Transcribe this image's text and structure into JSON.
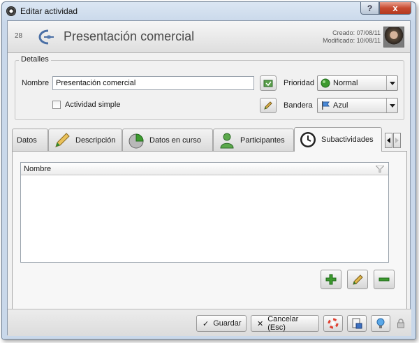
{
  "window": {
    "title": "Editar actividad",
    "help_glyph": "?",
    "close_glyph": "x"
  },
  "header": {
    "record_id": "28",
    "title": "Presentación comercial",
    "created": "Creado: 07/08/11",
    "modified": "Modificado: 10/08/11"
  },
  "details": {
    "legend": "Detalles",
    "name_label": "Nombre",
    "name_value": "Presentación comercial",
    "simple_label": "Actividad simple",
    "priority_label": "Prioridad",
    "priority_value": "Normal",
    "flag_label": "Bandera",
    "flag_value": "Azul"
  },
  "tabs": [
    {
      "label": "Datos"
    },
    {
      "label": "Descripción"
    },
    {
      "label": "Datos en curso"
    },
    {
      "label": "Participantes"
    },
    {
      "label": "Subactividades",
      "active": true
    }
  ],
  "grid": {
    "column_header": "Nombre"
  },
  "footer": {
    "save_label": "Guardar",
    "save_mark": "✓",
    "cancel_label": "Cancelar (Esc)",
    "cancel_mark": "✕"
  },
  "colors": {
    "accent_green": "#3d9a2f",
    "title_blue": "#4a6fa5",
    "close_red": "#c74a2f"
  }
}
